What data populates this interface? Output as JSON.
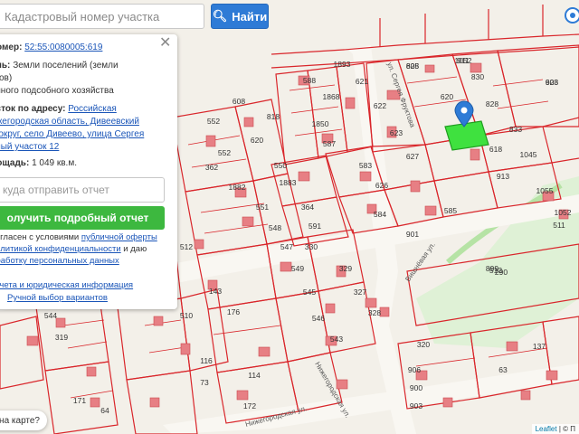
{
  "search": {
    "placeholder": "Кадастровый номер участка",
    "button_label": "Найти"
  },
  "info_panel": {
    "number_label": "номер:",
    "number_value": "52:55:0080005:619",
    "category_label": "ель:",
    "category_value": "Земли поселений (земли",
    "category_value_2": "ктов)",
    "use_value": "ичного подсобного хозяйства",
    "address_label": "асток по адресу:",
    "address_line1": "Российская",
    "address_line2": "ижегородская область, Дивеевский",
    "address_line3": "й округ, село Дивеево, улица Сергея",
    "address_line4": "ьный участок 12",
    "area_label": "лощадь:",
    "area_value": "1 049 кв.м.",
    "send_placeholder": "куда отправить отчет",
    "report_button": "олучить подробный отчет",
    "consent_line1_prefix": "согласен с условиями ",
    "consent_offer_link": "публичной оферты",
    "consent_line2_prefix": "",
    "consent_policy_link": "политикой конфиденциальности",
    "consent_line2_suffix": " и даю",
    "consent_data_link": "бработку персональных данных",
    "legal_link": "отчета и юридическая информация",
    "manual_link": "Ручной выбор вариантов"
  },
  "where_button": "на карте?",
  "attribution": {
    "leaflet": "Leaflet",
    "sep": " | © П"
  },
  "map": {
    "selected_parcel": "619",
    "streets": [
      "ул. Сергея Фруктова",
      "Нижегородская ул.",
      "Нижегородская ул.",
      "Вишнёвая ул."
    ],
    "parcel_labels": [
      "825",
      "911",
      "923",
      "1893",
      "588",
      "621",
      "830",
      "620",
      "828",
      "1868",
      "622",
      "833",
      "1850",
      "623",
      "618",
      "1045",
      "587",
      "627",
      "913",
      "583",
      "1055",
      "626",
      "1052",
      "584",
      "585",
      "901",
      "899",
      "608",
      "818",
      "552",
      "620",
      "552",
      "362",
      "550",
      "1882",
      "1883",
      "551",
      "364",
      "548",
      "591",
      "547",
      "330",
      "549",
      "329",
      "545",
      "327",
      "546",
      "328",
      "543",
      "320",
      "544",
      "319",
      "510",
      "145",
      "143",
      "176",
      "116",
      "73",
      "114",
      "172",
      "171",
      "64",
      "63",
      "137",
      "906",
      "900",
      "903",
      "512",
      "513",
      "511",
      "290",
      "608",
      "1052",
      "608"
    ],
    "colors": {
      "selected": "#3fe13f",
      "boundary": "#d9262b",
      "building": "#e77f84",
      "park": "#cfe8c2"
    }
  }
}
